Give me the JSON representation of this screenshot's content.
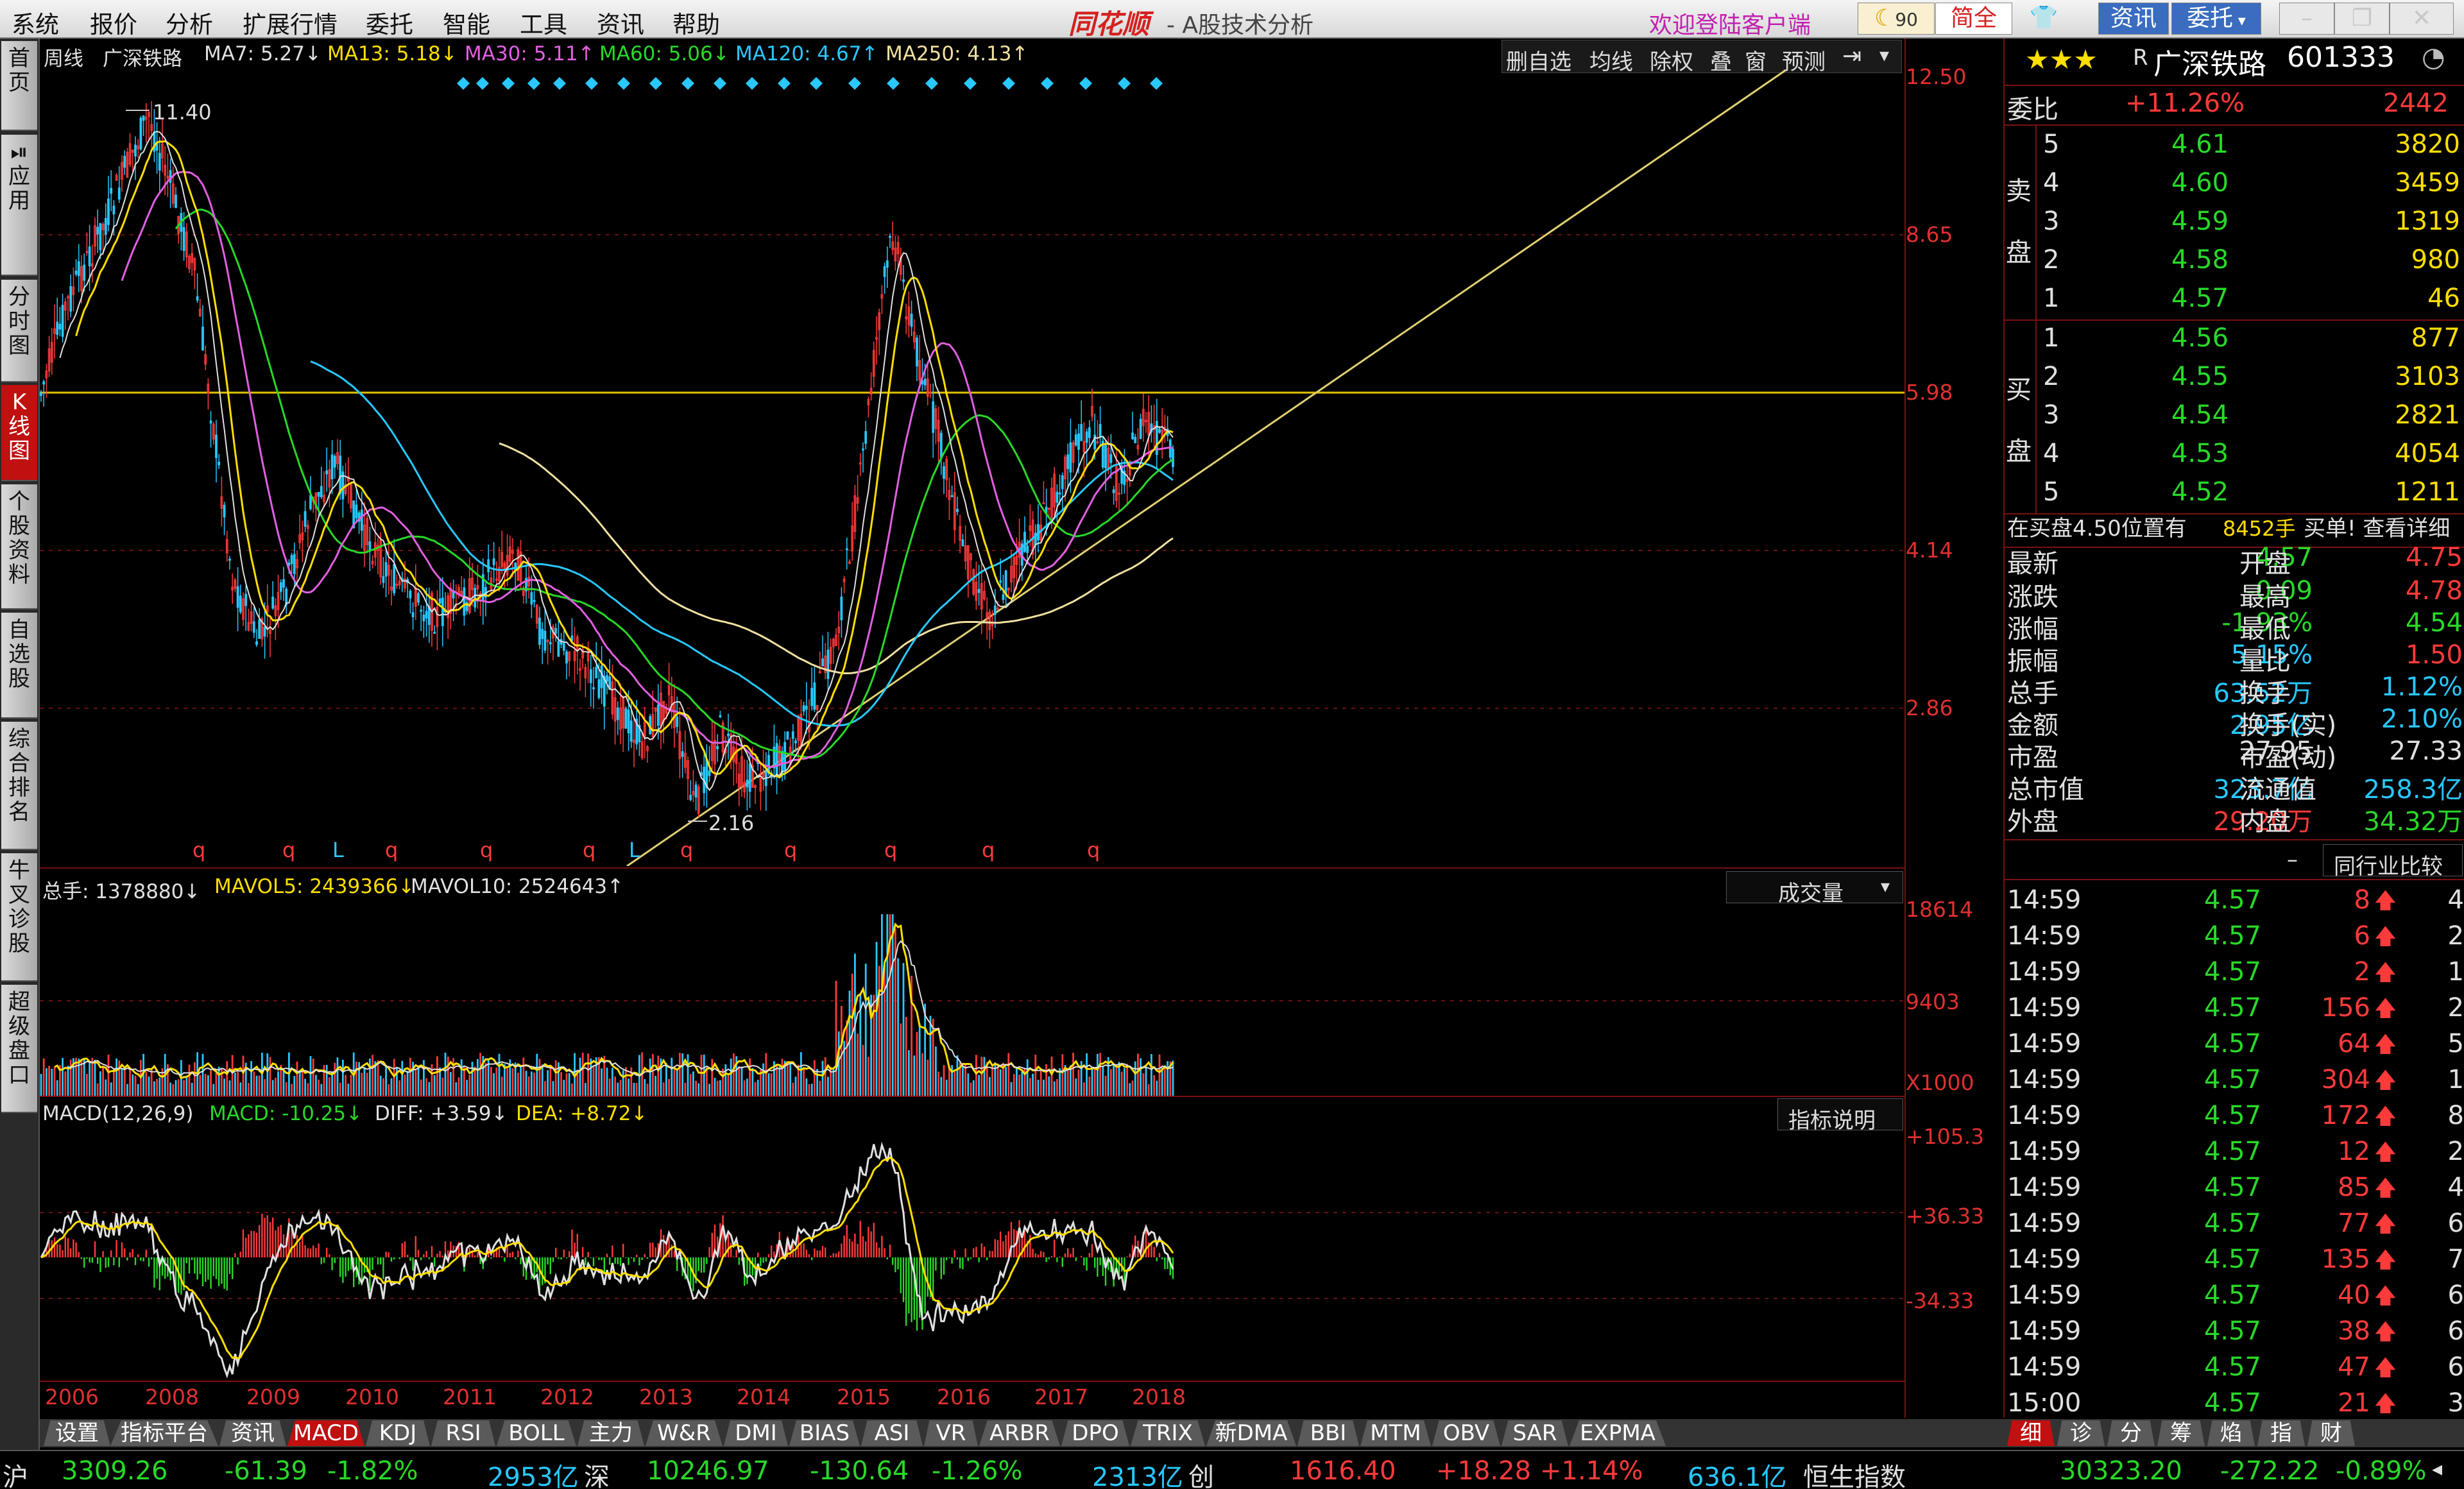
{
  "menubar": {
    "items": [
      "系统",
      "报价",
      "分析",
      "扩展行情",
      "委托",
      "智能",
      "工具",
      "资讯",
      "帮助"
    ],
    "brand": "同花顺",
    "sub": "- A股技术分析",
    "welcome": "欢迎登陆客户端",
    "jianquan": "简全",
    "zixun": "资讯",
    "weituo": "委托",
    "weather_num": "90"
  },
  "leftnav": [
    "首页",
    "应用",
    "分时图",
    "K线图",
    "个股资料",
    "自选股",
    "综合排名",
    "牛叉诊股",
    "超级盘口"
  ],
  "chart_header": {
    "period": "周线",
    "name": "广深铁路",
    "ma7": "MA7: 5.27↓",
    "ma13": "MA13: 5.18↓",
    "ma30": "MA30: 5.11↑",
    "ma60": "MA60: 5.06↓",
    "ma120": "MA120: 4.67↑",
    "ma250": "MA250: 4.13↑"
  },
  "chart_toolbar": [
    "删自选",
    "均线",
    "除权",
    "叠",
    "窗",
    "预测"
  ],
  "price_axis": [
    "12.50",
    "8.65",
    "5.98",
    "4.14",
    "2.86"
  ],
  "annotations": {
    "high": "11.40",
    "low": "2.16"
  },
  "markers": [
    "q",
    "q",
    "L",
    "q",
    "q",
    "q",
    "L",
    "q",
    "q",
    "q",
    "q",
    "q"
  ],
  "volume": {
    "header_total": "总手: 1378880↓",
    "mavol5": "MAVOL5: 2439366↓",
    "mavol10": "MAVOL10: 2524643↑",
    "selector": "成交量",
    "axis": [
      "18614",
      "9403"
    ],
    "unit": "X1000"
  },
  "macd": {
    "header": "MACD(12,26,9)",
    "macd": "MACD: -10.25↓",
    "diff": "DIFF: +3.59↓",
    "dea": "DEA: +8.72↓",
    "explain": "指标说明",
    "axis": [
      "+105.3",
      "+36.33",
      "-34.33"
    ]
  },
  "years": [
    "2006",
    "2008",
    "2009",
    "2010",
    "2011",
    "2012",
    "2013",
    "2014",
    "2015",
    "2016",
    "2017",
    "2018"
  ],
  "bottom_tabs": [
    "设置",
    "指标平台",
    "资讯",
    "MACD",
    "KDJ",
    "RSI",
    "BOLL",
    "主力",
    "W&R",
    "DMI",
    "BIAS",
    "ASI",
    "VR",
    "ARBR",
    "DPO",
    "TRIX",
    "新DMA",
    "BBI",
    "MTM",
    "OBV",
    "SAR",
    "EXPMA"
  ],
  "stock": {
    "stars": "★★★",
    "prefix": "R",
    "name": "广深铁路",
    "code": "601333"
  },
  "order_book": {
    "weibi_label": "委比",
    "weibi": "+11.26%",
    "weicha": "2442",
    "sell_label": "卖盘",
    "buy_label": "买盘",
    "sell": [
      [
        "5",
        "4.61",
        "3820"
      ],
      [
        "4",
        "4.60",
        "3459"
      ],
      [
        "3",
        "4.59",
        "1319"
      ],
      [
        "2",
        "4.58",
        "980"
      ],
      [
        "1",
        "4.57",
        "46"
      ]
    ],
    "buy": [
      [
        "1",
        "4.56",
        "877"
      ],
      [
        "2",
        "4.55",
        "3103"
      ],
      [
        "3",
        "4.54",
        "2821"
      ],
      [
        "4",
        "4.53",
        "4054"
      ],
      [
        "5",
        "4.52",
        "1211"
      ]
    ],
    "notice_a": "在买盘4.50位置有",
    "notice_b": "8452手",
    "notice_c": "买单! 查看详细"
  },
  "quote": [
    [
      "最新",
      "4.57",
      "开盘",
      "4.75"
    ],
    [
      "涨跌",
      "-0.09",
      "最高",
      "4.78"
    ],
    [
      "涨幅",
      "-1.93%",
      "最低",
      "4.54"
    ],
    [
      "振幅",
      "5.15%",
      "量比",
      "1.50"
    ],
    [
      "总手",
      "63.52万",
      "换手",
      "1.12%"
    ],
    [
      "金额",
      "2.95亿",
      "换手(实)",
      "2.10%"
    ],
    [
      "市盈",
      "27.95",
      "市盈(动)",
      "27.33"
    ],
    [
      "总市值",
      "323.7亿",
      "流通值",
      "258.3亿"
    ],
    [
      "外盘",
      "29.20万",
      "内盘",
      "34.32万"
    ]
  ],
  "compare_btn": "同行业比较",
  "ticks": [
    [
      "14:59",
      "4.57",
      "8",
      "4"
    ],
    [
      "14:59",
      "4.57",
      "6",
      "2"
    ],
    [
      "14:59",
      "4.57",
      "2",
      "1"
    ],
    [
      "14:59",
      "4.57",
      "156",
      "2"
    ],
    [
      "14:59",
      "4.57",
      "64",
      "5"
    ],
    [
      "14:59",
      "4.57",
      "304",
      "1"
    ],
    [
      "14:59",
      "4.57",
      "172",
      "8"
    ],
    [
      "14:59",
      "4.57",
      "12",
      "2"
    ],
    [
      "14:59",
      "4.57",
      "85",
      "4"
    ],
    [
      "14:59",
      "4.57",
      "77",
      "6"
    ],
    [
      "14:59",
      "4.57",
      "135",
      "7"
    ],
    [
      "14:59",
      "4.57",
      "40",
      "6"
    ],
    [
      "14:59",
      "4.57",
      "38",
      "6"
    ],
    [
      "14:59",
      "4.57",
      "47",
      "6"
    ],
    [
      "15:00",
      "4.57",
      "21",
      "3"
    ]
  ],
  "right_tabs": [
    "细",
    "诊",
    "分",
    "筹",
    "焰",
    "指",
    "财"
  ],
  "status": {
    "sh_label": "沪",
    "sh_val": "3309.26",
    "sh_chg": "-61.39",
    "sh_pct": "-1.82%",
    "sh_amt": "2953亿",
    "sz_label": "深",
    "sz_val": "10246.97",
    "sz_chg": "-130.64",
    "sz_pct": "-1.26%",
    "sz_amt": "2313亿",
    "cy_label": "创",
    "cy_val": "1616.40",
    "cy_chg": "+18.28",
    "cy_pct": "+1.14%",
    "cy_amt": "636.1亿",
    "hs_label": "恒生指数",
    "hs_val": "30323.20",
    "hs_chg": "-272.22",
    "hs_pct": "-0.89%"
  },
  "colors": {
    "up": "#ff3a3a",
    "down": "#29d829",
    "accent": "#c01010",
    "ma7": "#e0e0e0",
    "ma13": "#ffde00",
    "ma30": "#e060e0",
    "ma60": "#29d829",
    "ma120": "#29c8ff",
    "ma250": "#f0e0a0"
  }
}
